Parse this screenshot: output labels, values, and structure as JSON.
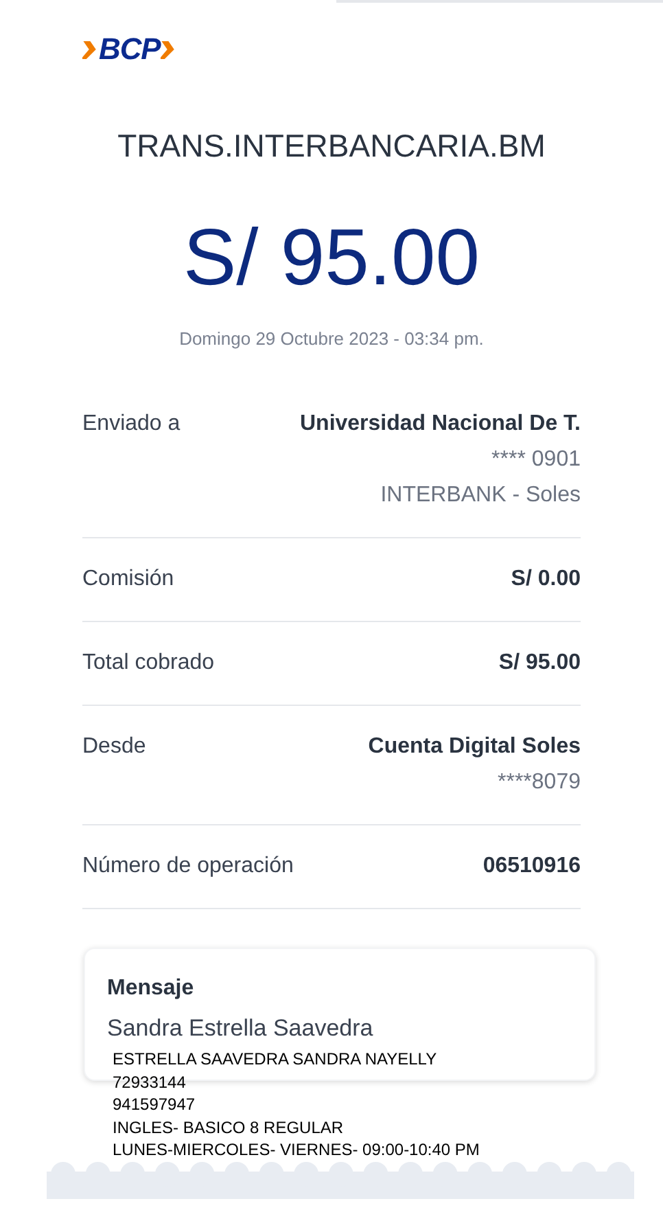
{
  "logo": {
    "text": "BCP"
  },
  "title": "TRANS.INTERBANCARIA.BM",
  "amount": "S/ 95.00",
  "date": "Domingo 29 Octubre 2023 - 03:34 pm.",
  "details": [
    {
      "label": "Enviado a",
      "values": [
        "Universidad Nacional De T.",
        "**** 0901",
        "INTERBANK - Soles"
      ]
    },
    {
      "label": "Comisión",
      "values": [
        "S/ 0.00"
      ]
    },
    {
      "label": "Total cobrado",
      "values": [
        "S/ 95.00"
      ]
    },
    {
      "label": "Desde",
      "values": [
        "Cuenta Digital Soles",
        "****8079"
      ]
    },
    {
      "label": "Número de operación",
      "values": [
        "06510916"
      ]
    }
  ],
  "message": {
    "heading": "Mensaje",
    "text": "Sandra Estrella Saavedra"
  },
  "note_lines": [
    "ESTRELLA SAAVEDRA SANDRA NAYELLY",
    "72933144",
    "941597947",
    "INGLES- BASICO 8 REGULAR",
    "LUNES-MIERCOLES- VIERNES- 09:00-10:40 PM"
  ]
}
